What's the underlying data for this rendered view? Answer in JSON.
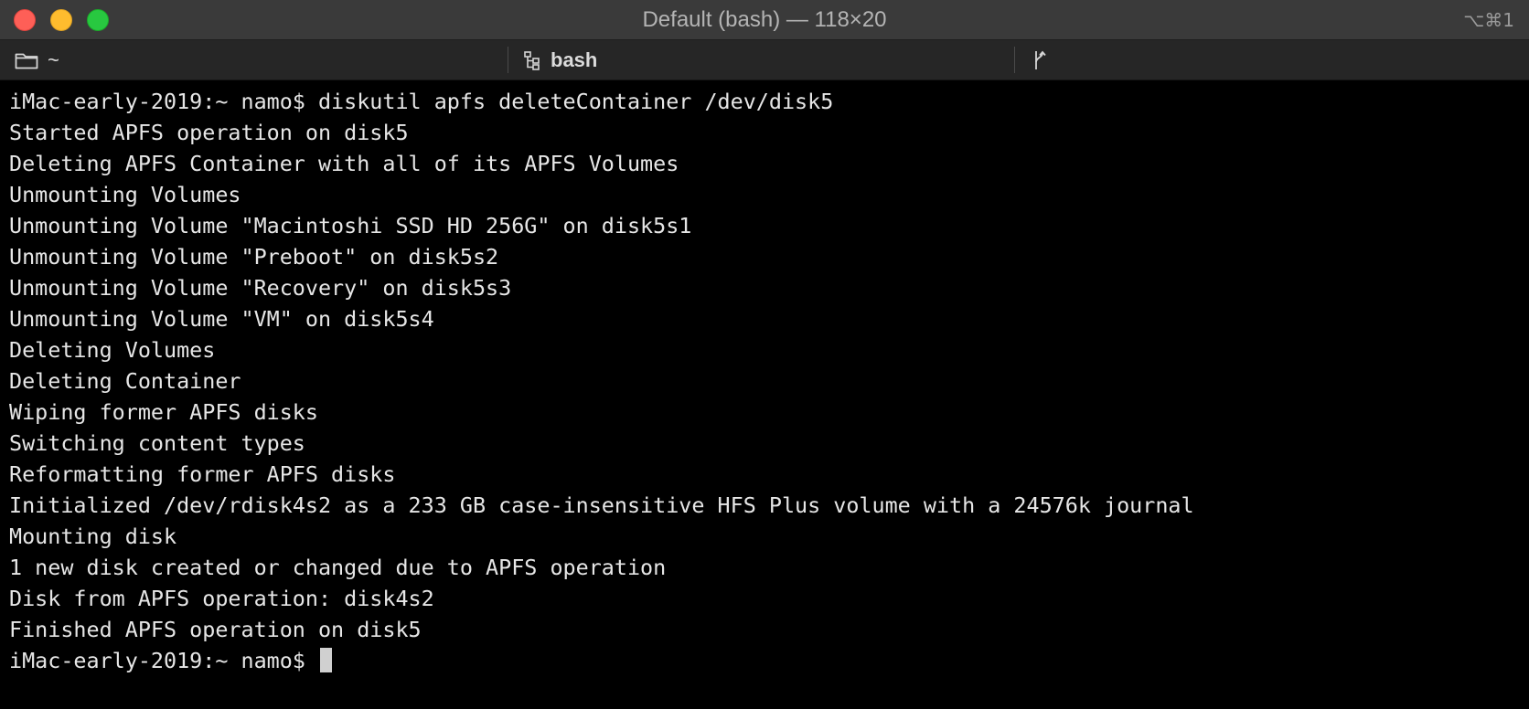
{
  "window": {
    "title": "Default (bash) — 118×20",
    "shortcut": "⌥⌘1"
  },
  "tabbar": {
    "directory_label": "~",
    "process_label": "bash"
  },
  "colors": {
    "titlebar": "#3a3a3a",
    "tabbar": "#262626",
    "terminal_bg": "#000000",
    "terminal_fg": "#e6e6e6",
    "close": "#fe5f57",
    "minimize": "#febc2e",
    "zoom": "#28c840"
  },
  "terminal": {
    "lines": [
      "iMac-early-2019:~ namo$ diskutil apfs deleteContainer /dev/disk5",
      "Started APFS operation on disk5",
      "Deleting APFS Container with all of its APFS Volumes",
      "Unmounting Volumes",
      "Unmounting Volume \"Macintoshi SSD HD 256G\" on disk5s1",
      "Unmounting Volume \"Preboot\" on disk5s2",
      "Unmounting Volume \"Recovery\" on disk5s3",
      "Unmounting Volume \"VM\" on disk5s4",
      "Deleting Volumes",
      "Deleting Container",
      "Wiping former APFS disks",
      "Switching content types",
      "Reformatting former APFS disks",
      "Initialized /dev/rdisk4s2 as a 233 GB case-insensitive HFS Plus volume with a 24576k journal",
      "Mounting disk",
      "1 new disk created or changed due to APFS operation",
      "Disk from APFS operation: disk4s2",
      "Finished APFS operation on disk5"
    ],
    "prompt": "iMac-early-2019:~ namo$ "
  }
}
